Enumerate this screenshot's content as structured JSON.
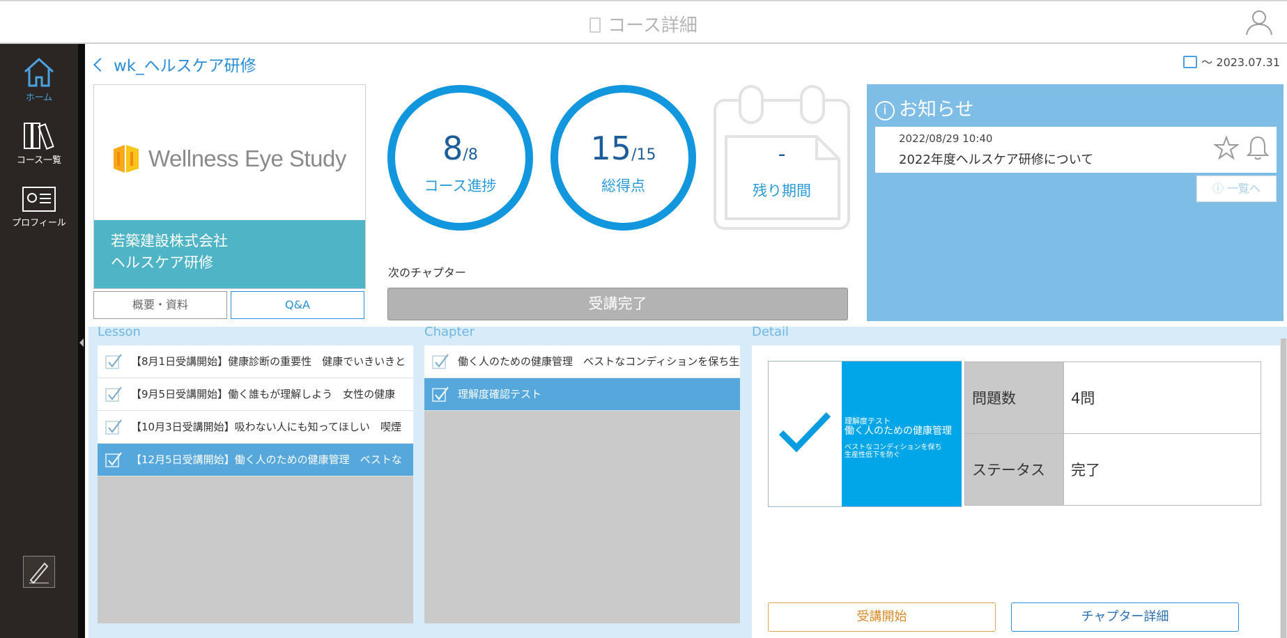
{
  "header": {
    "title": "コース詳細",
    "book_icon": "notebook-icon",
    "user_icon": "user-icon"
  },
  "sidebar": {
    "items": [
      {
        "label": "ホーム",
        "icon": "home-icon",
        "active": true
      },
      {
        "label": "コース一覧",
        "icon": "books-icon",
        "active": false
      },
      {
        "label": "プロフィール",
        "icon": "certificate-icon",
        "active": false
      }
    ],
    "edit_icon": "pencil-icon"
  },
  "course": {
    "title": "wk_ヘルスケア研修",
    "period": "～ 2023.07.31",
    "logo_text": "Wellness Eye Study",
    "band_line1": "若築建設株式会社",
    "band_line2": "ヘルスケア研修",
    "tab_overview": "概要・資料",
    "tab_qa": "Q&A"
  },
  "stats": {
    "progress_value": "8",
    "progress_total": "/8",
    "progress_label": "コース進捗",
    "score_value": "15",
    "score_total": "/15",
    "score_label": "総得点",
    "remain_value": "-",
    "remain_label": "残り期間"
  },
  "next_chapter": {
    "label": "次のチャプター",
    "button": "受講完了"
  },
  "notice": {
    "title": "お知らせ",
    "item_date": "2022/08/29 10:40",
    "item_text": "2022年度ヘルスケア研修について",
    "more": "一覧へ"
  },
  "lesson": {
    "title": "Lesson",
    "rows": [
      "【8月1日受講開始】健康診断の重要性　健康でいきいきと",
      "【9月5日受講開始】働く誰もが理解しよう　女性の健康",
      "【10月3日受講開始】吸わない人にも知ってほしい　喫煙",
      "【12月5日受講開始】働く人のための健康管理　ベストな"
    ],
    "selected_index": 3
  },
  "chapter": {
    "title": "Chapter",
    "rows": [
      "働く人のための健康管理　ベストなコンディションを保ち生産",
      "理解度確認テスト"
    ],
    "selected_index": 1
  },
  "detail": {
    "title": "Detail",
    "card_small": "理解度テスト",
    "card_main": "働く人のための健康管理",
    "card_sub1": "ベストなコンディションを保ち",
    "card_sub2": "生産性低下を防ぐ",
    "rows": [
      {
        "label": "問題数",
        "value": "4問"
      },
      {
        "label": "ステータス",
        "value": "完了"
      }
    ],
    "btn_start": "受講開始",
    "btn_chapter_detail": "チャプター詳細"
  }
}
